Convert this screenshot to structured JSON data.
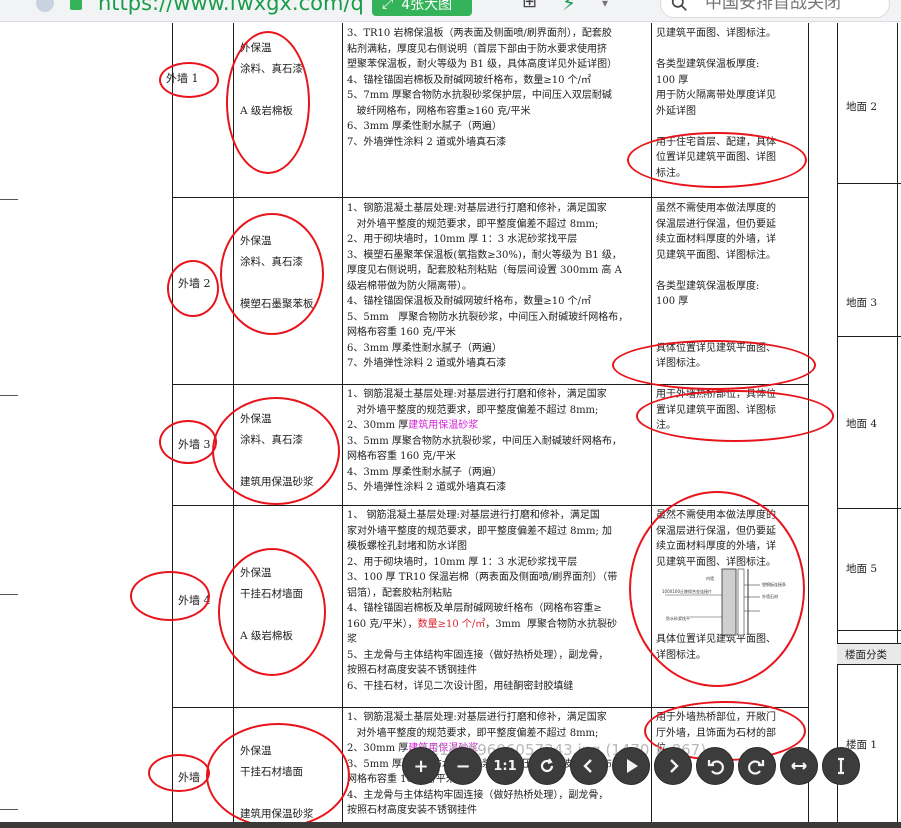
{
  "browser": {
    "url": "https://www.fwxgx.com/q",
    "tool_label": "4张大图",
    "search_placeholder": "中国安排首战关闭",
    "colors": {
      "accent": "#1a9d4a",
      "chip": "#35b35a"
    }
  },
  "document": {
    "rows": [
      {
        "label": "外墙 1",
        "material": [
          "外保温",
          "涂料、真石漆",
          "",
          "A 级岩棉板"
        ],
        "steps": [
          "3、TR10 岩棉保温板（两表面及侧面喷/刷界面剂），配套胶",
          "粘剂满粘，厚度见右侧说明（首层下部由于防水要求使用挤",
          "塑聚苯保温板，耐火等级为 B1 级，具体高度详见外延详图）",
          "4、锚栓锚固岩棉板及耐碱网玻纤格布，数量≥10 个/㎡",
          "5、7mm 厚聚合物防水抗裂砂浆保护层，中间压入双层耐碱",
          "   玻纤网格布，网格布容重≥160 克/平米",
          "6、3mm 厚柔性耐水腻子（两遍）",
          "7、外墙弹性涂料 2 道或外墙真石漆"
        ],
        "notes": [
          "见建筑平面图、详图标注。",
          "",
          "各类型建筑保温板厚度:",
          "100 厚",
          "用于防火隔离带处厚度详见",
          "外延详图",
          "",
          "用于住宅首层、配建，具体",
          "位置详见建筑平面图、详图",
          "标注。"
        ]
      },
      {
        "label": "外墙 2",
        "material": [
          "外保温",
          "涂料、真石漆",
          "",
          "模塑石墨聚苯板"
        ],
        "steps": [
          "1、钢筋混凝土基层处理:对基层进行打磨和修补，满足国家",
          "   对外墙平整度的规范要求，即平整度偏差不超过 8mm;",
          "2、用于砌块墙时，10mm 厚 1：3 水泥砂浆找平层",
          "3、模塑石墨聚苯保温板(氧指数≥30%)，耐火等级为 B1 级，",
          "厚度见右侧说明，配套胶粘剂粘贴（每层间设置 300mm 高 A",
          "级岩棉带做为防火隔离带）。",
          "4、锚栓锚固保温板及耐碱网玻纤格布，数量≥10 个/㎡",
          "5、5mm   厚聚合物防水抗裂砂浆，中间压入耐碱玻纤网格布，",
          "网格布容重 160 克/平米",
          "6、3mm 厚柔性耐水腻子（两遍）",
          "7、外墙弹性涂料 2 道或外墙真石漆"
        ],
        "red_text": "10",
        "notes": [
          "虽然不需使用本做法厚度的",
          "保温层进行保温，但仍要延",
          "续立面材料厚度的外墙，详",
          "见建筑平面图、详图标注。",
          "",
          "各类型建筑保温板厚度:",
          "100 厚",
          "",
          "",
          "具体位置详见建筑平面图、",
          "详图标注。"
        ]
      },
      {
        "label": "外墙 3",
        "material": [
          "外保温",
          "涂料、真石漆",
          "",
          "建筑用保温砂浆"
        ],
        "steps": [
          "1、钢筋混凝土基层处理:对基层进行打磨和修补，满足国家",
          "   对外墙平整度的规范要求，即平整度偏差不超过 8mm;",
          "2、30mm 厚",
          "3、5mm 厚聚合物防水抗裂砂浆，中间压入耐碱玻纤网格布，",
          "网格布容重 160 克/平米",
          "4、3mm 厚柔性耐水腻子（两遍）",
          "5、外墙弹性涂料 2 道或外墙真石漆"
        ],
        "magenta_text": "建筑用保温砂浆",
        "notes": [
          "用于外墙热桥部位，具体位",
          "置详见建筑平面图、详图标",
          "注。"
        ]
      },
      {
        "label": "外墙 4",
        "material": [
          "外保温",
          "干挂石材墙面",
          "",
          "A 级岩棉板"
        ],
        "steps": [
          "1、 钢筋混凝土基层处理:对基层进行打磨和修补，满足国",
          "家对外墙平整度的规范要求，即平整度偏差不超过 8mm; 加",
          "模板螺栓孔封堵和防水详图",
          "2、用于砌块墙时，10mm 厚 1：3 水泥砂浆找平层",
          "3、100 厚 TR10 保温岩棉（两表面及侧面喷/刷界面剂）（带",
          "铝箔），配套胶粘剂粘贴",
          "4、锚栓锚固岩棉板及单层耐碱网玻纤格布（网格布容重≥",
          "160 克/平米），",
          "浆",
          "5、主龙骨与主体结构牢固连接（做好热桥处理），副龙骨，",
          "按照石材高度安装不锈钢挂件",
          "6、干挂石材，详见二次设计图，用硅酮密封胶填缝"
        ],
        "red_text": "数量≥10 个/㎡",
        "tail_text": "，3mm  厚聚合物防水抗裂砂",
        "notes": [
          "虽然不需使用本做法厚度的",
          "保温层进行保温，但仍要延",
          "续立面材料厚度的外墙，详",
          "见建筑平面图、详图标注。",
          "",
          "",
          "",
          "",
          "具体位置详见建筑平面图、",
          "详图标注。"
        ],
        "diagram_labels": [
          "内墙",
          "100X100丘陵保合金连接片",
          "塑钢板连接条",
          "外墙石材",
          "防水砂浆找平"
        ]
      },
      {
        "label": "外墙",
        "material": [
          "外保温",
          "干挂石材墙面",
          "",
          "建筑用保温砂浆"
        ],
        "steps": [
          "1、钢筋混凝土基层处理:对基层进行打磨和修补，满足国家",
          "   对外墙平整度的规范要求，即平整度偏差不超过 8mm;",
          "2、30mm 厚",
          "3、5mm 厚聚合物防水抗裂砂浆，中间压入耐碱玻纤网格布，",
          "网格布容重 160 克/平米",
          "4、主龙骨与主体结构牢固连接（做好热桥处理），副龙骨，",
          "按照石材高度安装不锈钢挂件"
        ],
        "magenta_text": "建筑用保温砂浆",
        "notes": [
          "用于外墙热桥部位，开敞门",
          "厅外墙，且饰面为石材的部",
          "位。"
        ]
      }
    ],
    "side": {
      "labels": [
        "地面 2",
        "地面 3",
        "地面 4",
        "地面 5",
        "楼面 1"
      ],
      "header": "楼面分类"
    },
    "watermark": "1214689606057343.jpg (1470 × 867)"
  },
  "viewer": {
    "buttons": [
      {
        "name": "zoom-in-button",
        "glyph": "+"
      },
      {
        "name": "zoom-out-button",
        "glyph": "−"
      },
      {
        "name": "actual-size-button",
        "glyph": "1:1"
      },
      {
        "name": "reset-button",
        "icon": "refresh-icon"
      },
      {
        "name": "previous-button",
        "icon": "chevron-left-icon"
      },
      {
        "name": "play-button",
        "icon": "play-icon"
      },
      {
        "name": "next-button",
        "icon": "chevron-right-icon"
      },
      {
        "name": "rotate-left-button",
        "icon": "rotate-left-icon"
      },
      {
        "name": "rotate-right-button",
        "icon": "rotate-right-icon"
      },
      {
        "name": "flip-horizontal-button",
        "icon": "flip-horizontal-icon"
      },
      {
        "name": "flip-vertical-button",
        "icon": "flip-vertical-icon"
      }
    ]
  }
}
